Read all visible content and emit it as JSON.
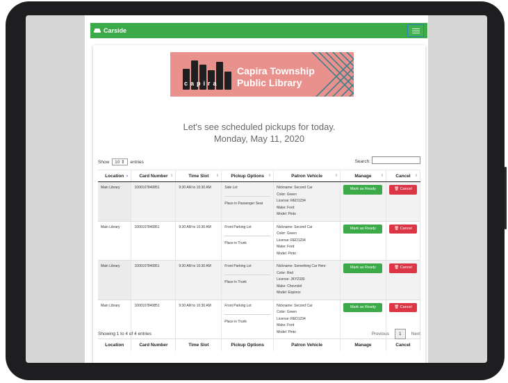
{
  "navbar": {
    "brand": "Carside",
    "menu_icon": "hamburger-icon",
    "color": "#3daa4a"
  },
  "logo": {
    "line1": "Capira Township",
    "line2": "Public Library",
    "book_letters": "capira",
    "color": "#e9918c"
  },
  "headline": {
    "line1": "Let's see scheduled pickups for today.",
    "line2": "Monday, May 11, 2020"
  },
  "controls": {
    "show_label": "Show",
    "show_value": "10",
    "entries_label": "entries",
    "search_label": "Search:"
  },
  "table": {
    "columns": [
      "Location",
      "Card Number",
      "Time Slot",
      "Pickup Options",
      "Patron Vehicle",
      "Manage",
      "Cancel"
    ],
    "rows": [
      {
        "location": "Main Library",
        "card": "1000107840851",
        "time": "9:30 AM to 10:30 AM",
        "option1": "Side Lot",
        "option2": "Place in Passenger Seat",
        "vehicle": [
          "Nickname: Second Car",
          "Color: Green",
          "License: RED1234",
          "Make: Ford",
          "Model: Pinto"
        ],
        "manage": "Mark as Ready",
        "cancel": "Cancel"
      },
      {
        "location": "Main Library",
        "card": "1000107840851",
        "time": "9:30 AM to 10:30 AM",
        "option1": "Front Parking Lot",
        "option2": "Place in Trunk",
        "vehicle": [
          "Nickname: Second Car",
          "Color: Green",
          "License: RED1234",
          "Make: Ford",
          "Model: Pinto"
        ],
        "manage": "Mark as Ready",
        "cancel": "Cancel"
      },
      {
        "location": "Main Library",
        "card": "1000107840851",
        "time": "9:30 AM to 10:30 AM",
        "option1": "Front Parking Lot",
        "option2": "Place in Trunk",
        "vehicle": [
          "Nickname: Something Car Here",
          "Color: Red",
          "License: JKY2330",
          "Make: Chevrolet",
          "Model: Equinox"
        ],
        "manage": "Mark as Ready",
        "cancel": "Cancel"
      },
      {
        "location": "Main Library",
        "card": "1000107840851",
        "time": "9:30 AM to 10:30 AM",
        "option1": "Front Parking Lot",
        "option2": "Place in Trunk",
        "vehicle": [
          "Nickname: Second Car",
          "Color: Green",
          "License: RED1234",
          "Make: Ford",
          "Model: Pinto"
        ],
        "manage": "Mark as Ready",
        "cancel": "Cancel"
      }
    ]
  },
  "footer": {
    "info": "Showing 1 to 4 of 4 entries",
    "previous": "Previous",
    "page": "1",
    "next": "Next"
  }
}
